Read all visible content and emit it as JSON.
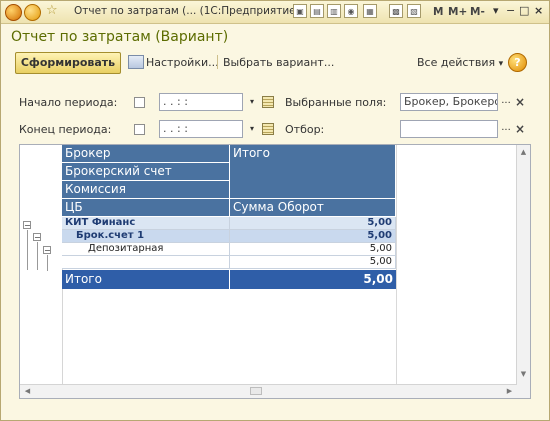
{
  "window": {
    "title": "Отчет по затратам (... (1С:Предприятие)",
    "menu_icons": [
      "home-icon",
      "chevron-down-icon",
      "favorite-star-icon",
      "save-icon",
      "print-icon",
      "preview-icon",
      "search-icon",
      "document-icon",
      "calculator-icon",
      "calendar-icon"
    ],
    "memory_buttons": [
      "M",
      "M+",
      "M-"
    ],
    "window_controls": [
      "▾",
      "−",
      "□",
      "×"
    ]
  },
  "form": {
    "title": "Отчет по затратам (Вариант)",
    "toolbar": {
      "generate_label": "Сформировать",
      "settings_label": "Настройки...",
      "choose_variant_label": "Выбрать вариант...",
      "all_actions_label": "Все действия",
      "all_actions_arrow": "▾",
      "help_label": "?"
    },
    "period": {
      "start_label": "Начало периода:",
      "end_label": "Конец периода:",
      "start_value": "  .  .       :  :  ",
      "end_value": "  .  .       :  :  ",
      "dropdown_glyph": "▾"
    },
    "selected_fields": {
      "label": "Выбранные поля:",
      "value": "Брокер, Брокерский сч",
      "select_glyph": "...",
      "clear_glyph": "×"
    },
    "filter": {
      "label": "Отбор:",
      "value": "",
      "select_glyph": "...",
      "clear_glyph": "×"
    },
    "report": {
      "header_left": [
        "Брокер",
        "Брокерский счет",
        "Комиссия",
        "ЦБ"
      ],
      "header_right_top": "Итого",
      "header_right_bottom": "Сумма Оборот",
      "rows": [
        {
          "label": "КИТ Финанс",
          "value": "5,00"
        },
        {
          "label": "Брок.счет 1",
          "value": "5,00"
        },
        {
          "label": "Депозитарная",
          "value": "5,00"
        },
        {
          "label": "",
          "value": "5,00"
        }
      ],
      "total_label": "Итого",
      "total_value": "5,00",
      "tree_glyph": "−"
    },
    "scrollbar": {
      "up": "▲",
      "down": "▼",
      "left": "◀",
      "right": "▶"
    }
  },
  "colors": {
    "header_blue": "#4a72a0",
    "row_light": "#dbe6f3",
    "row_mid": "#c9d9ee",
    "total_blue": "#2f5ea8",
    "title_green": "#5c6c00",
    "toolbar_button_yellow": "#e8cf62"
  }
}
